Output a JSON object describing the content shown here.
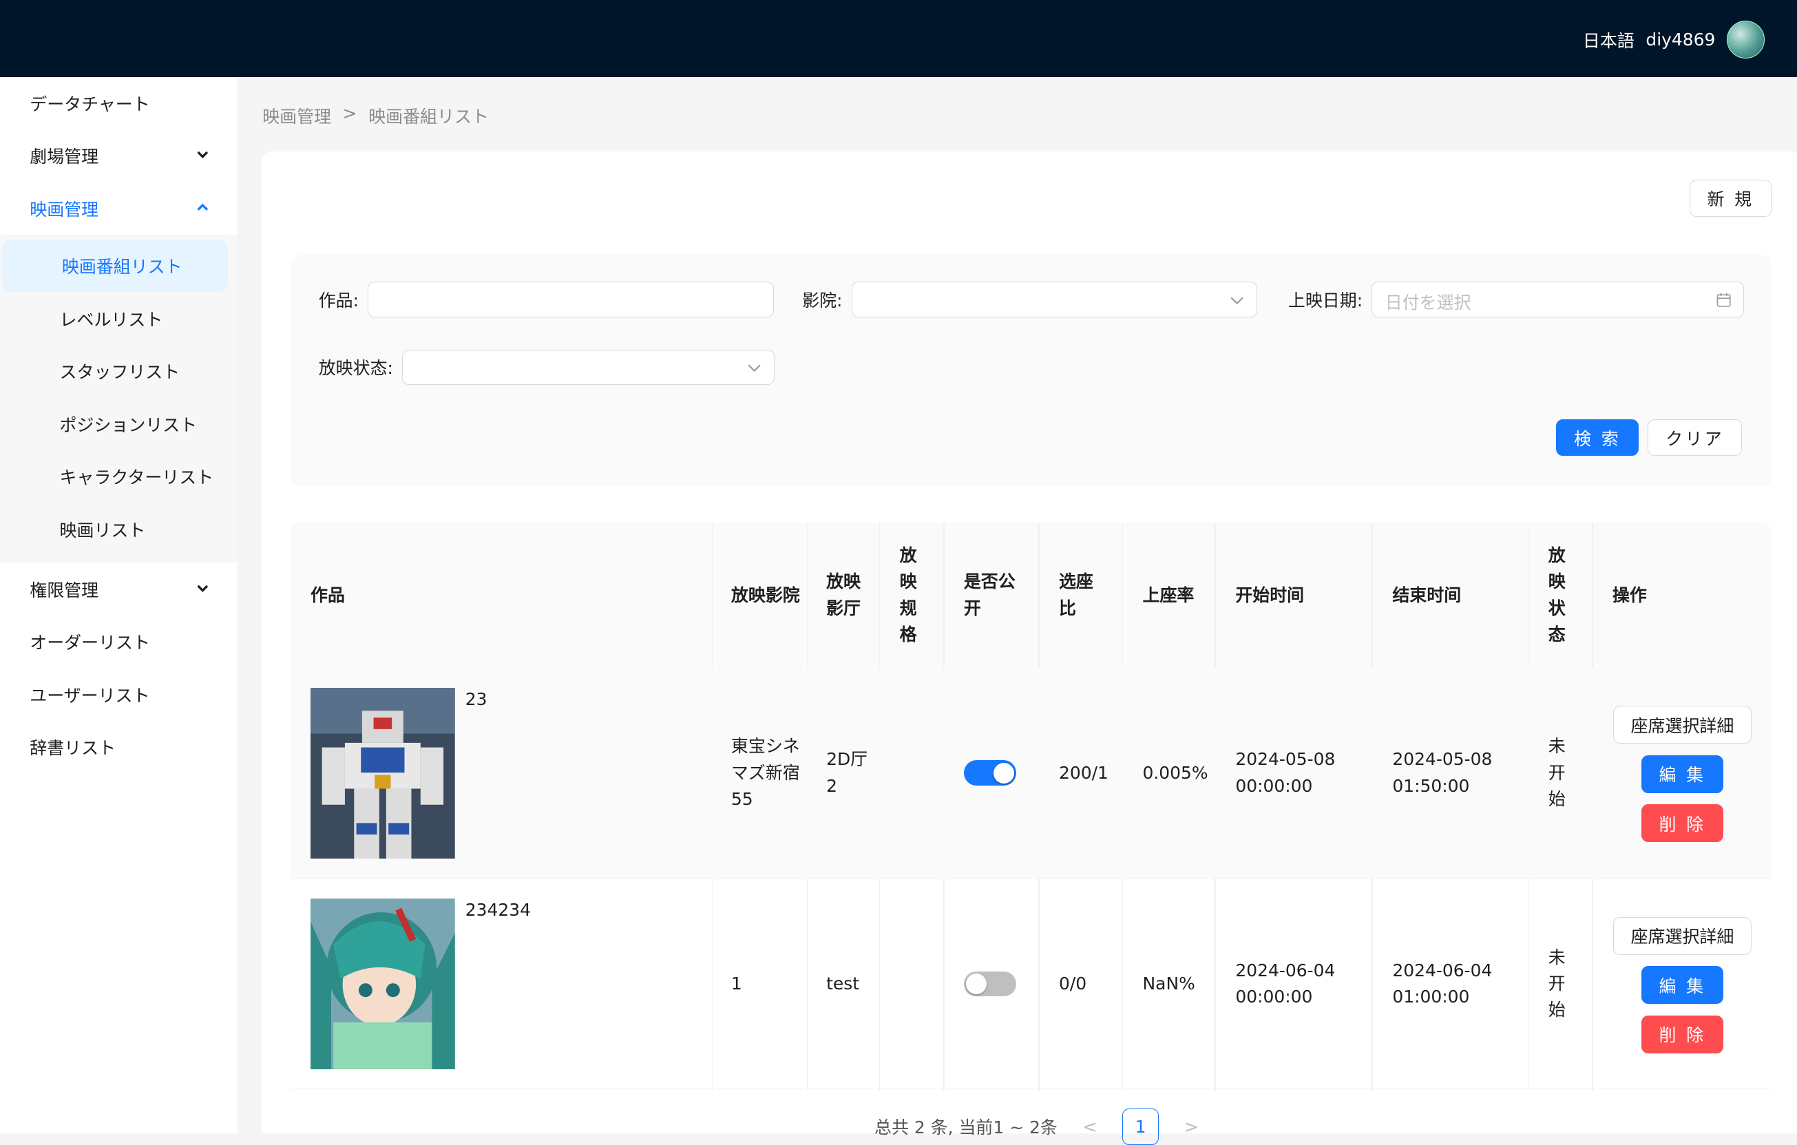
{
  "header": {
    "language": "日本語",
    "username": "diy4869"
  },
  "sidebar": {
    "items": [
      {
        "label": "データチャート"
      },
      {
        "label": "劇場管理"
      },
      {
        "label": "映画管理"
      }
    ],
    "submenu": [
      {
        "label": "映画番組リスト"
      },
      {
        "label": "レベルリスト"
      },
      {
        "label": "スタッフリスト"
      },
      {
        "label": "ポジションリスト"
      },
      {
        "label": "キャラクターリスト"
      },
      {
        "label": "映画リスト"
      }
    ],
    "items_after": [
      {
        "label": "権限管理"
      },
      {
        "label": "オーダーリスト"
      },
      {
        "label": "ユーザーリスト"
      },
      {
        "label": "辞書リスト"
      }
    ]
  },
  "breadcrumb": {
    "parent": "映画管理",
    "separator": ">",
    "current": "映画番組リスト"
  },
  "toolbar": {
    "new_label": "新 規"
  },
  "search": {
    "work_label": "作品:",
    "work_value": "",
    "cinema_label": "影院:",
    "cinema_value": "",
    "date_label": "上映日期:",
    "date_placeholder": "日付を選択",
    "status_label": "放映状态:",
    "status_value": "",
    "search_label": "検 索",
    "clear_label": "クリア"
  },
  "table": {
    "headers": {
      "work": "作品",
      "cinema": "放映影院",
      "hall": "放映影厅",
      "spec": "放映规格",
      "public": "是否公开",
      "seat_ratio": "选座比",
      "occupancy": "上座率",
      "start": "开始时间",
      "end": "结束时间",
      "status": "放映状态",
      "ops": "操作"
    },
    "rows": [
      {
        "title": "23",
        "cinema": "東宝シネマズ新宿55",
        "hall": "2D厅2",
        "spec": "",
        "public": true,
        "seat_ratio": "200/1",
        "occupancy": "0.005%",
        "start_date": "2024-05-08",
        "start_time": "00:00:00",
        "end_date": "2024-05-08",
        "end_time": "01:50:00",
        "status": "未开始",
        "seat_detail": "座席選択詳細",
        "edit": "編 集",
        "delete": "削 除"
      },
      {
        "title": "234234",
        "cinema": "1",
        "hall": "test",
        "spec": "",
        "public": false,
        "seat_ratio": "0/0",
        "occupancy": "NaN%",
        "start_date": "2024-06-04",
        "start_time": "00:00:00",
        "end_date": "2024-06-04",
        "end_time": "01:00:00",
        "status": "未开始",
        "seat_detail": "座席選択詳細",
        "edit": "編 集",
        "delete": "削 除"
      }
    ]
  },
  "pagination": {
    "summary": "总共 2 条, 当前1 ~ 2条",
    "current_page": "1",
    "prev": "<",
    "next": ">"
  },
  "colors": {
    "primary": "#1677ff",
    "danger": "#ff4d4f",
    "header_bg": "#001529"
  }
}
